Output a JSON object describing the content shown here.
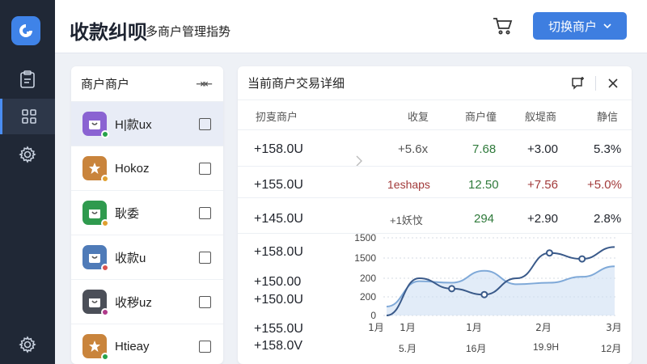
{
  "header": {
    "title": "收款纠呗",
    "subtitle": "多商户管理指势",
    "switch_label": "切换商户"
  },
  "merchants_panel": {
    "title": "商户商户",
    "collapse_label": "⇥⇤"
  },
  "merchants": [
    {
      "name": "H|款ux",
      "avatar_color": "#8a63d2",
      "status_color": "#27a34a",
      "icon": "wallet-icon"
    },
    {
      "name": "Hokoz",
      "avatar_color": "#c9843c",
      "status_color": "#e0a030",
      "icon": "star-icon"
    },
    {
      "name": "耿委",
      "avatar_color": "#2f9a4e",
      "status_color": "#e0a030",
      "icon": "wallet-icon"
    },
    {
      "name": "收款u",
      "avatar_color": "#4f7bb8",
      "status_color": "#d9534f",
      "icon": "wallet-icon"
    },
    {
      "name": "收秽uz",
      "avatar_color": "#4b4f58",
      "status_color": "#b03a8a",
      "icon": "wallet-icon"
    },
    {
      "name": "Htieay",
      "avatar_color": "#c9843c",
      "status_color": "#27a34a",
      "icon": "star-icon"
    }
  ],
  "detail": {
    "title": "当前商户交易详细",
    "columns": [
      "扨㕝商户",
      "收复",
      "商户僮",
      "舣堤商",
      "静信"
    ],
    "rows": [
      {
        "amount": "+158.0U",
        "c2": "+5.6x",
        "c3": "7.68",
        "c4": "+3.00",
        "c5": "5.3%"
      },
      {
        "amount": "+155.0U",
        "c2": "1eshaps",
        "c3": "12.50",
        "c4": "+7.56",
        "c5": "+5.0%"
      },
      {
        "amount": "+145.0U",
        "c2": "+1妖忟",
        "c3": "294",
        "c4": "+2.90",
        "c5": "2.8%"
      }
    ],
    "more_amounts": [
      "+158.0U",
      "+150.00",
      "+150.0U",
      "+155.0U",
      "+158.0V"
    ],
    "bottom_dates": [
      "5.月",
      "16月",
      "19.9H",
      "12月"
    ]
  },
  "chart_data": {
    "type": "line",
    "y_ticks": [
      "1500",
      "1500",
      "200",
      "200",
      "0"
    ],
    "x_ticks": [
      "1月",
      "1月",
      "1月",
      "2月",
      "3月"
    ],
    "series": [
      {
        "color": "#3a5a8a",
        "values": [
          0,
          250,
          180,
          140,
          250,
          420,
          380,
          460
        ]
      },
      {
        "color": "#7fa9d8",
        "values": [
          60,
          230,
          220,
          300,
          210,
          220,
          260,
          330
        ]
      }
    ]
  },
  "colors": {
    "accent": "#3e7ee0",
    "sidebar": "#202836"
  }
}
